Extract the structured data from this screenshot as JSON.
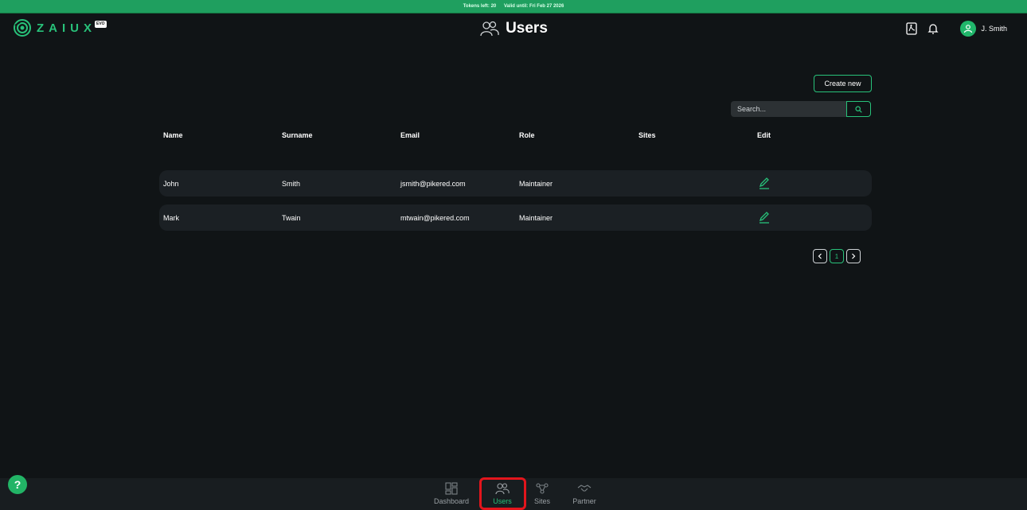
{
  "banner": {
    "tokens": "Tokens left: 20",
    "valid": "Valid until: Fri Feb 27 2026"
  },
  "header": {
    "logo_text": "ZAIUX",
    "logo_badge": "EVO",
    "title": "Users",
    "title_icon": "users-icon",
    "user_name": "J. Smith"
  },
  "actions": {
    "create_label": "Create new",
    "search_placeholder": "Search..."
  },
  "table": {
    "columns": [
      "Name",
      "Surname",
      "Email",
      "Role",
      "Sites",
      "Edit"
    ],
    "rows": [
      {
        "name": "John",
        "surname": "Smith",
        "email": "jsmith@pikered.com",
        "role": "Maintainer",
        "sites": ""
      },
      {
        "name": "Mark",
        "surname": "Twain",
        "email": "mtwain@pikered.com",
        "role": "Maintainer",
        "sites": ""
      }
    ]
  },
  "pagination": {
    "current": "1"
  },
  "bottom_nav": {
    "items": [
      {
        "label": "Dashboard",
        "icon": "dashboard-icon",
        "active": false
      },
      {
        "label": "Users",
        "icon": "users-icon",
        "active": true
      },
      {
        "label": "Sites",
        "icon": "sites-icon",
        "active": false
      },
      {
        "label": "Partner",
        "icon": "partner-icon",
        "active": false
      }
    ]
  },
  "help_label": "?",
  "colors": {
    "accent": "#28c27a",
    "banner": "#1f9f5f",
    "background": "#101416",
    "highlight": "#e3151c"
  }
}
